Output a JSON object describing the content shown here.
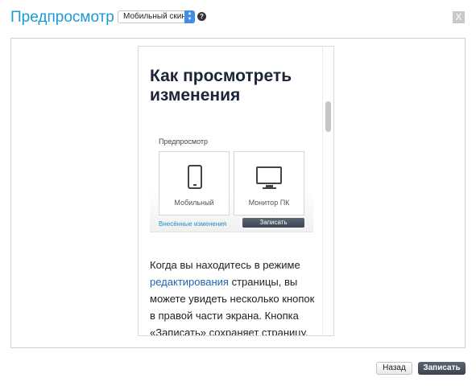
{
  "dialog": {
    "title": "Предпросмотр",
    "skin_select": {
      "value": "Мобильный скин"
    },
    "help_icon": "?",
    "close_label": "X"
  },
  "preview": {
    "heading": "Как просмотреть изменения",
    "screenshot": {
      "label": "Предпросмотр",
      "mobile_label": "Мобильный",
      "desktop_label": "Монитор ПК",
      "changes_link": "Внесённые изменения",
      "save_label": "Записать"
    },
    "body": {
      "text_before": "Когда вы находитесь в режиме ",
      "link": "редактирования",
      "text_after": " страницы, вы можете увидеть несколько кнопок в правой части экрана. Кнопка «Записать» сохраняет страницу,"
    }
  },
  "footer": {
    "back_label": "Назад",
    "save_label": "Записать"
  },
  "colors": {
    "title": "#1a9bd7",
    "primary_button": "#3b4452",
    "link": "#1f63b5"
  }
}
